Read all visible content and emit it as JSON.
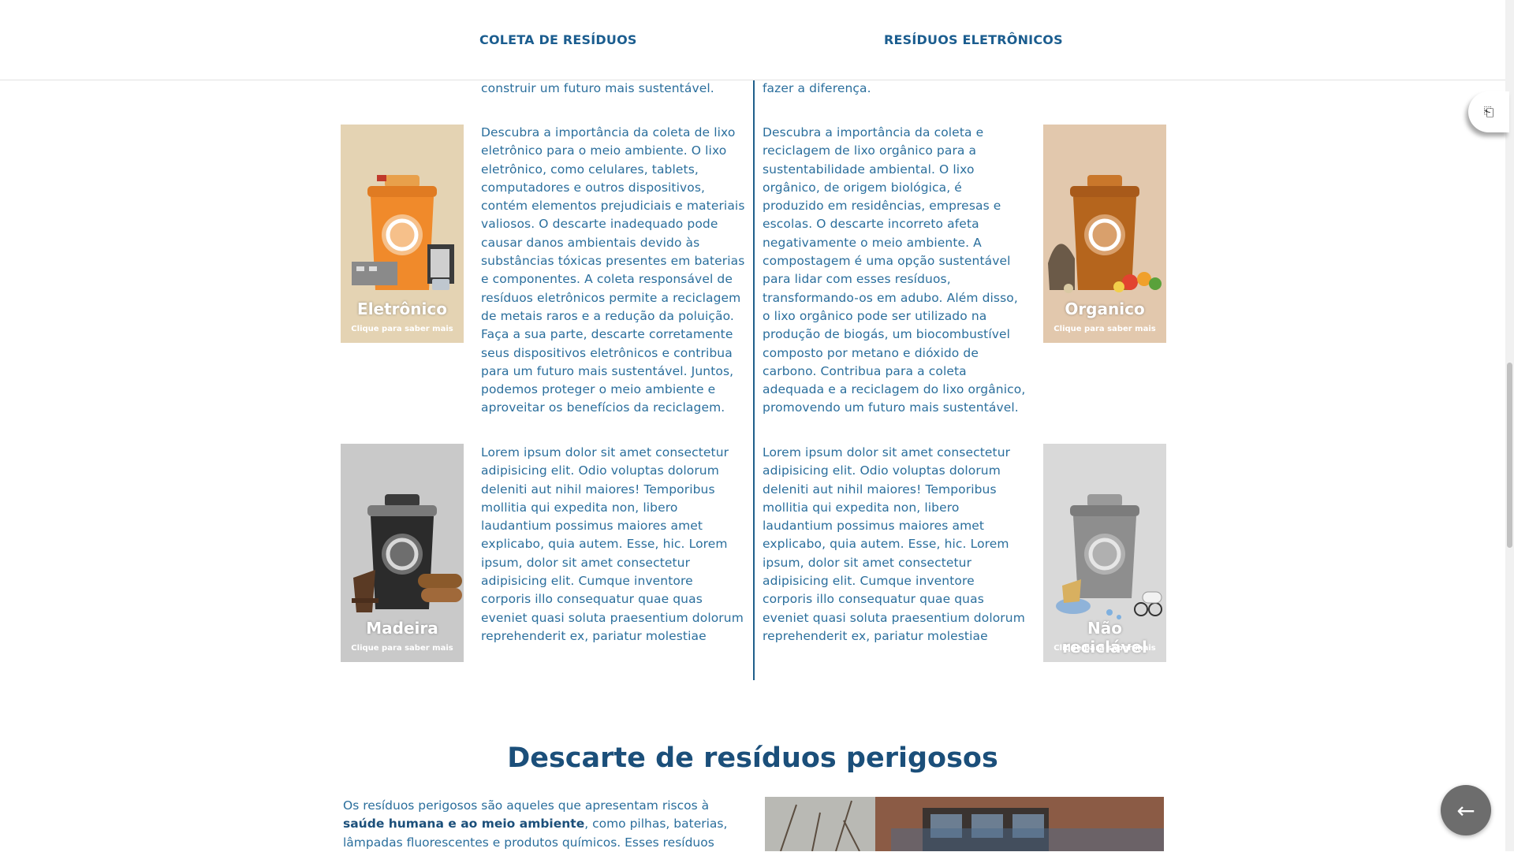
{
  "nav": {
    "item1": "COLETA DE RESÍDUOS",
    "item2": "RESÍDUOS ELETRÔNICOS"
  },
  "top_fragments": {
    "left": "construir um futuro mais sustentável.",
    "right": "fazer a diferença."
  },
  "cards": {
    "eletronico": {
      "title": "Eletrônico",
      "subtitle": "Clique para saber mais"
    },
    "organico": {
      "title": "Organico",
      "subtitle": "Clique para saber mais"
    },
    "madeira": {
      "title": "Madeira",
      "subtitle": "Clique para saber mais"
    },
    "nao_reciclavel": {
      "title": "Não reciclável",
      "subtitle": "Clique para saber mais"
    }
  },
  "texts": {
    "eletronico": "Descubra a importância da coleta de lixo eletrônico para o meio ambiente. O lixo eletrônico, como celulares, tablets, computadores e outros dispositivos, contém elementos prejudiciais e materiais valiosos. O descarte inadequado pode causar danos ambientais devido às substâncias tóxicas presentes em baterias e componentes. A coleta responsável de resíduos eletrônicos permite a reciclagem de metais raros e a redução da poluição. Faça a sua parte, descarte corretamente seus dispositivos eletrônicos e contribua para um futuro mais sustentável. Juntos, podemos proteger o meio ambiente e aproveitar os benefícios da reciclagem.",
    "organico": "Descubra a importância da coleta e reciclagem de lixo orgânico para a sustentabilidade ambiental. O lixo orgânico, de origem biológica, é produzido em residências, empresas e escolas. O descarte incorreto afeta negativamente o meio ambiente. A compostagem é uma opção sustentável para lidar com esses resíduos, transformando-os em adubo. Além disso, o lixo orgânico pode ser utilizado na produção de biogás, um biocombustível composto por metano e dióxido de carbono. Contribua para a coleta adequada e a reciclagem do lixo orgânico, promovendo um futuro mais sustentável.",
    "madeira": "Lorem ipsum dolor sit amet consectetur adipisicing elit. Odio voluptas dolorum deleniti aut nihil maiores! Temporibus mollitia qui expedita non, libero laudantium possimus maiores amet explicabo, quia autem. Esse, hic. Lorem ipsum, dolor sit amet consectetur adipisicing elit. Cumque inventore corporis illo consequatur quae quas eveniet quasi soluta praesentium dolorum reprehenderit ex, pariatur molestiae",
    "nao_reciclavel": "Lorem ipsum dolor sit amet consectetur adipisicing elit. Odio voluptas dolorum deleniti aut nihil maiores! Temporibus mollitia qui expedita non, libero laudantium possimus maiores amet explicabo, quia autem. Esse, hic. Lorem ipsum, dolor sit amet consectetur adipisicing elit. Cumque inventore corporis illo consequatur quae quas eveniet quasi soluta praesentium dolorum reprehenderit ex, pariatur molestiae"
  },
  "hazard": {
    "title": "Descarte de resíduos perigosos",
    "text_before": "Os resíduos perigosos são aqueles que apresentam riscos à ",
    "text_bold": "saúde humana e ao meio ambiente",
    "text_after": ", como pilhas, baterias, lâmpadas fluorescentes e produtos químicos. Esses resíduos"
  },
  "icons": {
    "side_button": "copy-icon",
    "back_button": "arrow-left-icon"
  },
  "colors": {
    "brand": "#1b5d8f",
    "text": "#2a6e9c",
    "bin_orange": "#f08a2b",
    "bin_brown": "#b5651d",
    "bin_black": "#2b2b2b",
    "bin_gray": "#8e8e8e"
  }
}
